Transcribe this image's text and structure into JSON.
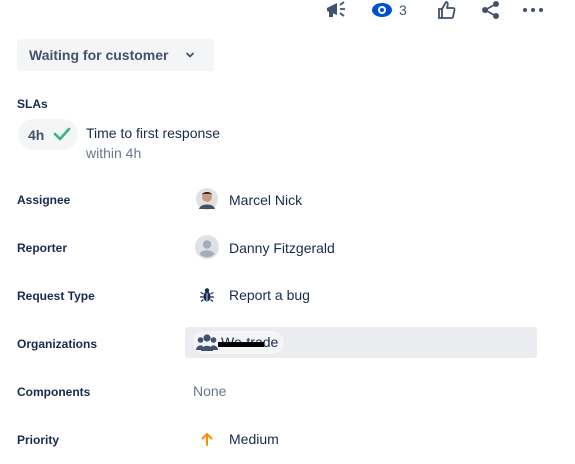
{
  "toolbar": {
    "feedback_icon": "megaphone-icon",
    "watch_icon": "eye-icon",
    "watch_count": "3",
    "vote_icon": "thumbs-up-icon",
    "share_icon": "share-icon",
    "more_icon": "more-icon"
  },
  "status": {
    "label": "Waiting for customer"
  },
  "sla": {
    "section_label": "SLAs",
    "badge": "4h",
    "badge_icon": "check-icon",
    "title": "Time to first response",
    "subtitle": "within 4h",
    "status_color": "#36b37e"
  },
  "fields": {
    "assignee": {
      "label": "Assignee",
      "value": "Marcel Nick"
    },
    "reporter": {
      "label": "Reporter",
      "value": "Danny Fitzgerald"
    },
    "request_type": {
      "label": "Request Type",
      "value": "Report a bug"
    },
    "organizations": {
      "label": "Organizations",
      "value": "We-trade"
    },
    "components": {
      "label": "Components",
      "value": "None"
    },
    "priority": {
      "label": "Priority",
      "value": "Medium",
      "color": "#ff8b00"
    }
  }
}
